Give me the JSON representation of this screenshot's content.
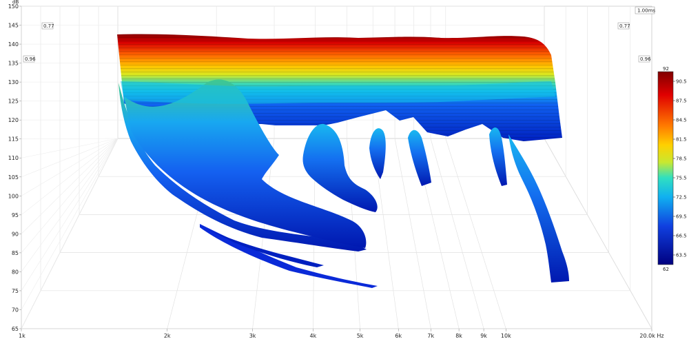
{
  "chart_data": {
    "type": "waterfall",
    "axis_unit_y": "dB",
    "y_ticks": [
      "150",
      "145",
      "140",
      "135",
      "130",
      "125",
      "120",
      "115",
      "110",
      "105",
      "100",
      "95",
      "90",
      "85",
      "80",
      "75",
      "70",
      "65"
    ],
    "x_ticks": [
      "1k",
      "2k",
      "3k",
      "4k",
      "5k",
      "6k",
      "7k",
      "8k",
      "9k",
      "10k",
      "20.0k Hz"
    ],
    "x_tick_values": [
      1000,
      2000,
      3000,
      4000,
      5000,
      6000,
      7000,
      8000,
      9000,
      10000,
      20000
    ],
    "ylim": [
      65,
      150
    ],
    "xlim": [
      1000,
      20000
    ],
    "x_scale": "log",
    "time_label": "1.00ms",
    "depth_labels": [
      "0.77",
      "0.96"
    ],
    "colorbar": {
      "max_label": "92",
      "min_label": "62",
      "ticks": [
        "90.5",
        "87.5",
        "84.5",
        "81.5",
        "78.5",
        "75.5",
        "72.5",
        "69.5",
        "66.5",
        "63.5"
      ],
      "range": [
        62,
        92
      ]
    },
    "colors": {
      "red": "#b00000",
      "orange": "#ff8a00",
      "yellow": "#e8e81a",
      "cyan": "#10c8e0",
      "blue": "#0a3ae0",
      "navy": "#000090"
    }
  }
}
